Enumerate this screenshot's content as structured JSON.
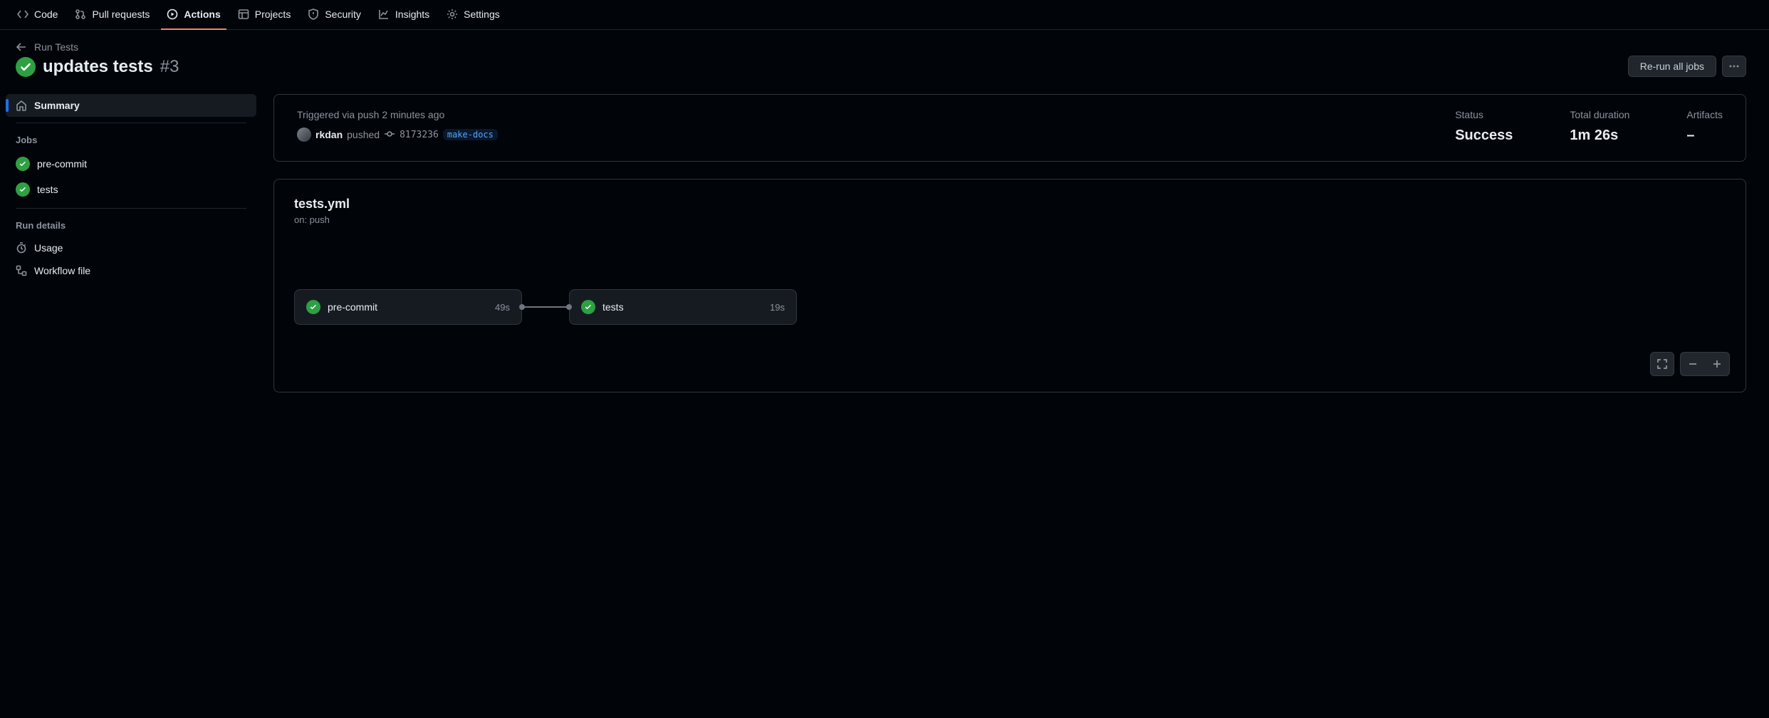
{
  "nav": {
    "code": "Code",
    "pull_requests": "Pull requests",
    "actions": "Actions",
    "projects": "Projects",
    "security": "Security",
    "insights": "Insights",
    "settings": "Settings"
  },
  "header": {
    "back_label": "Run Tests",
    "run_title": "updates tests",
    "run_number": "#3",
    "rerun_label": "Re-run all jobs"
  },
  "sidebar": {
    "summary": "Summary",
    "jobs_heading": "Jobs",
    "jobs": [
      {
        "name": "pre-commit"
      },
      {
        "name": "tests"
      }
    ],
    "run_details_heading": "Run details",
    "usage": "Usage",
    "workflow_file": "Workflow file"
  },
  "summary": {
    "triggered_label": "Triggered via push 2 minutes ago",
    "actor": "rkdan",
    "pushed": "pushed",
    "commit_sha": "8173236",
    "branch": "make-docs",
    "status_label": "Status",
    "status_value": "Success",
    "duration_label": "Total duration",
    "duration_value": "1m 26s",
    "artifacts_label": "Artifacts",
    "artifacts_value": "–"
  },
  "graph": {
    "workflow_file": "tests.yml",
    "on_label": "on: push",
    "jobs": [
      {
        "name": "pre-commit",
        "duration": "49s"
      },
      {
        "name": "tests",
        "duration": "19s"
      }
    ]
  }
}
